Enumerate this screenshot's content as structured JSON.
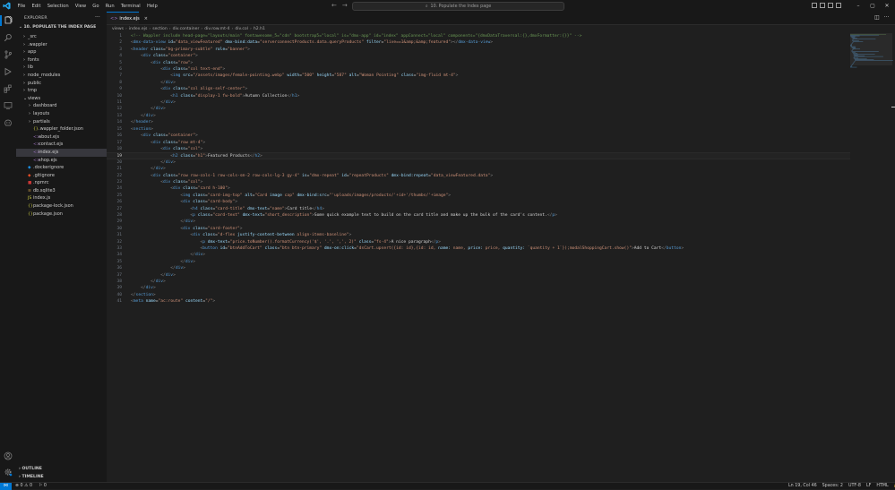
{
  "window": {
    "menu": [
      "File",
      "Edit",
      "Selection",
      "View",
      "Go",
      "Run",
      "Terminal",
      "Help"
    ],
    "command_center": "10. Populate the Index page",
    "controls": [
      "–",
      "▢",
      "✕"
    ],
    "accent": "#0078d4"
  },
  "sidebar": {
    "title": "EXPLORER",
    "more": "···",
    "root_folder": "10. POPULATE THE INDEX PAGE",
    "items": [
      {
        "chev": "›",
        "label": "_src",
        "indent": 1,
        "kind": "folder"
      },
      {
        "chev": "›",
        "label": ".wappler",
        "indent": 1,
        "kind": "folder"
      },
      {
        "chev": "›",
        "label": "app",
        "indent": 1,
        "kind": "folder"
      },
      {
        "chev": "›",
        "label": "fonts",
        "indent": 1,
        "kind": "folder"
      },
      {
        "chev": "›",
        "label": "lib",
        "indent": 1,
        "kind": "folder"
      },
      {
        "chev": "›",
        "label": "node_modules",
        "indent": 1,
        "kind": "folder"
      },
      {
        "chev": "›",
        "label": "public",
        "indent": 1,
        "kind": "folder"
      },
      {
        "chev": "›",
        "label": "tmp",
        "indent": 1,
        "kind": "folder"
      },
      {
        "chev": "⌄",
        "label": "views",
        "indent": 1,
        "kind": "folder"
      },
      {
        "chev": "›",
        "label": "dashboard",
        "indent": 2,
        "kind": "folder"
      },
      {
        "chev": "›",
        "label": "layouts",
        "indent": 2,
        "kind": "folder"
      },
      {
        "chev": "›",
        "label": "partials",
        "indent": 2,
        "kind": "folder"
      },
      {
        "chev": "",
        "label": ".wappler_folder.json",
        "indent": 2,
        "kind": "json"
      },
      {
        "chev": "",
        "label": "about.ejs",
        "indent": 2,
        "kind": "ejs"
      },
      {
        "chev": "",
        "label": "contact.ejs",
        "indent": 2,
        "kind": "ejs"
      },
      {
        "chev": "",
        "label": "index.ejs",
        "indent": 2,
        "kind": "ejs",
        "selected": true
      },
      {
        "chev": "",
        "label": "shop.ejs",
        "indent": 2,
        "kind": "ejs"
      },
      {
        "chev": "",
        "label": ".dockerignore",
        "indent": 1,
        "kind": "docker"
      },
      {
        "chev": "",
        "label": ".gitignore",
        "indent": 1,
        "kind": "git"
      },
      {
        "chev": "",
        "label": ".npmrc",
        "indent": 1,
        "kind": "npm"
      },
      {
        "chev": "",
        "label": "db.sqlite3",
        "indent": 1,
        "kind": "db"
      },
      {
        "chev": "",
        "label": "index.js",
        "indent": 1,
        "kind": "js"
      },
      {
        "chev": "",
        "label": "package-lock.json",
        "indent": 1,
        "kind": "json"
      },
      {
        "chev": "",
        "label": "package.json",
        "indent": 1,
        "kind": "json"
      }
    ],
    "outline": "OUTLINE",
    "timeline": "TIMELINE"
  },
  "editor": {
    "tab": {
      "label": "index.ejs",
      "close": "×"
    },
    "breadcrumb": [
      "views",
      "index.ejs",
      "section",
      "div.container",
      "div.row.mt-4",
      "div.col",
      "h2.h1"
    ],
    "active_line": 19,
    "lines": [
      "<!-- Wappler include head-page=\"layouts/main\" fontawesome_5=\"cdn\" bootstrap5=\"local\" is=\"dmx-app\" id=\"index\" appConnect=\"local\" components=\"{dmxDataTraversal:{},dmxFormatter:{}}\" -->",
      "<dmx-data-view id=\"data_viewFeatured\" dmx-bind:data=\"serverconnectProducts.data.queryProducts\" filter=\"live==1&amp;&amp;featured\"></dmx-data-view>",
      "<header class=\"bg-primary-subtle\" role=\"banner\">",
      "    <div class=\"container\">",
      "        <div class=\"row\">",
      "            <div class=\"col text-end\">",
      "                <img src=\"/assets/images/female-pointing.webp\" width=\"500\" height=\"587\" alt=\"Woman Pointing\" class=\"img-fluid mt-4\">",
      "            </div>",
      "            <div class=\"col align-self-center\">",
      "                <h1 class=\"display-1 fw-bold\">Autumn Collection</h1>",
      "            </div>",
      "        </div>",
      "    </div>",
      "</header>",
      "<section>",
      "    <div class=\"container\">",
      "        <div class=\"row mt-4\">",
      "            <div class=\"col\">",
      "                <h2 class=\"h1\">Featured Products</h2>",
      "            </div>",
      "        </div>",
      "        <div class=\"row row-cols-1 row-cols-sm-2 row-cols-lg-3 gy-4\" is=\"dmx-repeat\" id=\"repeatProducts\" dmx-bind:repeat=\"data_viewFeatured.data\">",
      "            <div class=\"col\">",
      "                <div class=\"card h-100\">",
      "                    <img class=\"card-img-top\" alt=\"Card image cap\" dmx-bind:src=\"'uploads/images/products/'+id+'/thumbs/'+image\">",
      "                    <div class=\"card-body\">",
      "                        <h4 class=\"card-title\" dmx-text=\"name\">Card title</h4>",
      "                        <p class=\"card-text\" dmx-text=\"short_description\">Some quick example text to build on the card title and make up the bulk of the card's content.</p>",
      "                    </div>",
      "                    <div class=\"card-footer\">",
      "                        <div class=\"d-flex justify-content-between align-items-baseline\">",
      "                            <p dmx-text=\"price.toNumber().formatCurrency('$', '.', ',', 2)\" class=\"fs-4\">A nice paragraph</p>",
      "                            <button id=\"btnAddToCart\" class=\"btn btn-primary\" dmx-on:click=\"dsCart.upsert({id: id},{id: id, name: name, price: price, quantity: `quantity + 1`});modalShoppingCart.show()\">Add to Cart</button>",
      "                        </div>",
      "                    </div>",
      "                </div>",
      "            </div>",
      "        </div>",
      "    </div>",
      "</section>",
      "<meta name=\"ac:route\" content=\"/\">"
    ]
  },
  "statusbar": {
    "remote": "⋈",
    "problems": "⊗ 0 ⚠ 0",
    "ports": "⚐ 0",
    "position": "Ln 19, Col 46",
    "spaces": "Spaces: 2",
    "encoding": "UTF-8",
    "eol": "LF",
    "language": "HTML",
    "bell": "🔔"
  }
}
